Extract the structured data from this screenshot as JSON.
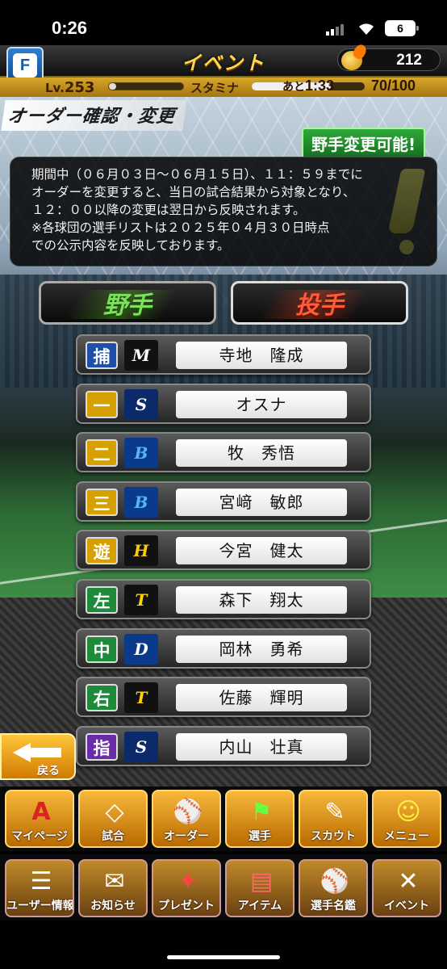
{
  "status": {
    "time": "0:26",
    "battery": "6"
  },
  "header": {
    "f_badge": "F",
    "title": "イベント",
    "currency": "212"
  },
  "level": {
    "lv_prefix": "Lv.",
    "lv": "253",
    "exp_fraction": 0.1,
    "stamina_label": "スタミナ",
    "ato": "あと",
    "timer": "1:33",
    "stamina_value": "70/100",
    "stamina_fraction": 0.7
  },
  "page": {
    "title": "オーダー確認・変更",
    "changeable": "野手変更可能!"
  },
  "notice": {
    "lines": [
      "期間中（０６月０３日〜０６月１５日）、１１：５９までに",
      "オーダーを変更すると、当日の試合結果から対象となり、",
      "１２：００以降の変更は翌日から反映されます。",
      "※各球団の選手リストは２０２５年０４月３０日時点",
      "での公示内容を反映しております。"
    ]
  },
  "tabs": {
    "fielder": "野手",
    "pitcher": "投手"
  },
  "roster": [
    {
      "pos": "捕",
      "pos_color": "#1f4fa8",
      "team": "M",
      "team_bg": "#111111",
      "team_fg": "#ffffff",
      "name": "寺地　隆成"
    },
    {
      "pos": "一",
      "pos_color": "#d6a000",
      "team": "S",
      "team_bg": "#0b2a6a",
      "team_fg": "#ffffff",
      "name": "オスナ"
    },
    {
      "pos": "二",
      "pos_color": "#d6a000",
      "team": "B",
      "team_bg": "#0b3a8a",
      "team_fg": "#4fb6ff",
      "name": "牧　秀悟"
    },
    {
      "pos": "三",
      "pos_color": "#d6a000",
      "team": "B",
      "team_bg": "#0b3a8a",
      "team_fg": "#4fb6ff",
      "name": "宮﨑　敏郎"
    },
    {
      "pos": "遊",
      "pos_color": "#d6a000",
      "team": "H",
      "team_bg": "#111111",
      "team_fg": "#ffcc00",
      "name": "今宮　健太"
    },
    {
      "pos": "左",
      "pos_color": "#1e8a3a",
      "team": "T",
      "team_bg": "#111111",
      "team_fg": "#ffd200",
      "name": "森下　翔太"
    },
    {
      "pos": "中",
      "pos_color": "#1e8a3a",
      "team": "D",
      "team_bg": "#0b3a8a",
      "team_fg": "#ffffff",
      "name": "岡林　勇希"
    },
    {
      "pos": "右",
      "pos_color": "#1e8a3a",
      "team": "T",
      "team_bg": "#111111",
      "team_fg": "#ffd200",
      "name": "佐藤　輝明"
    },
    {
      "pos": "指",
      "pos_color": "#6a2ca8",
      "team": "S",
      "team_bg": "#0b2a6a",
      "team_fg": "#ffffff",
      "name": "内山　壮真"
    }
  ],
  "back": {
    "label": "戻る"
  },
  "menu_main": [
    {
      "label": "マイページ",
      "icon": "A"
    },
    {
      "label": "試合",
      "icon": "◇"
    },
    {
      "label": "オーダー",
      "icon": "⚾"
    },
    {
      "label": "選手",
      "icon": "⚑"
    },
    {
      "label": "スカウト",
      "icon": "✎"
    },
    {
      "label": "メニュー",
      "icon": "☺"
    }
  ],
  "menu_sub": [
    {
      "label": "ユーザー情報",
      "icon": "☰"
    },
    {
      "label": "お知らせ",
      "icon": "✉"
    },
    {
      "label": "プレゼント",
      "icon": "✦"
    },
    {
      "label": "アイテム",
      "icon": "▤"
    },
    {
      "label": "選手名鑑",
      "icon": "⚾"
    },
    {
      "label": "イベント",
      "icon": "✕"
    }
  ]
}
